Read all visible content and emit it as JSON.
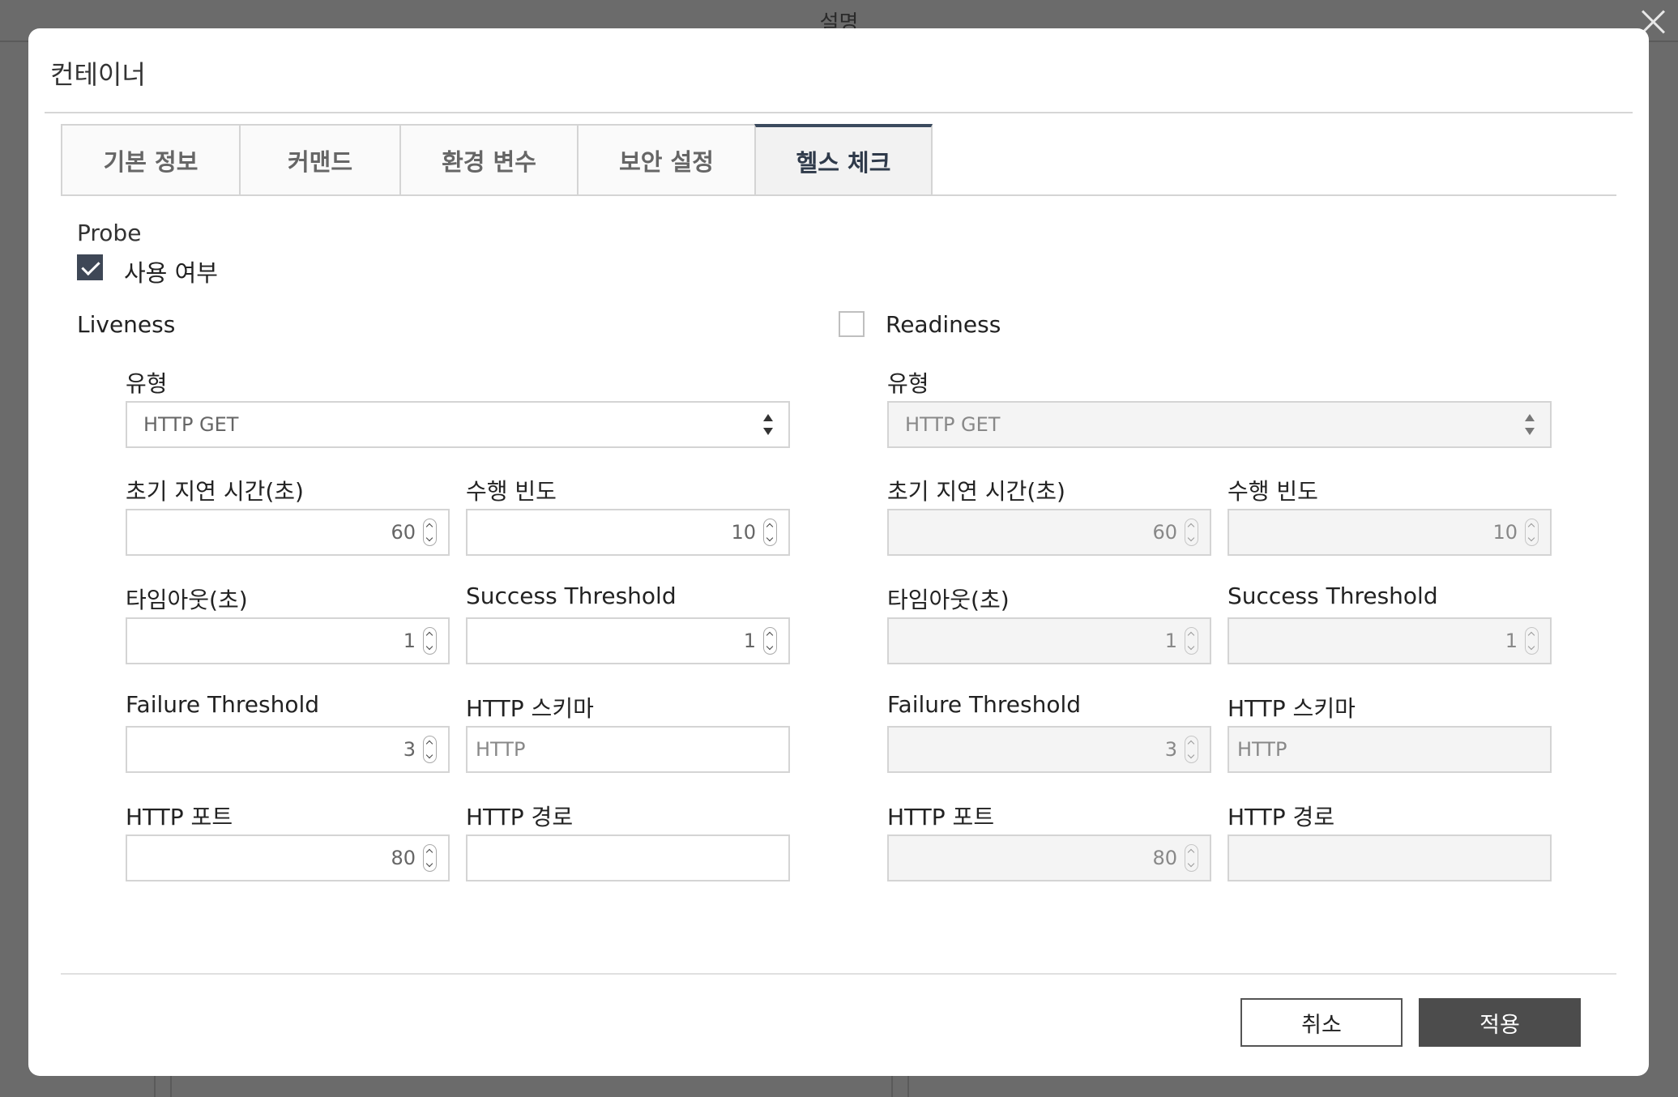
{
  "background": {
    "title": "설명"
  },
  "dialog": {
    "title": "컨테이너",
    "tabs": [
      {
        "label": "기본 정보",
        "active": false
      },
      {
        "label": "커맨드",
        "active": false
      },
      {
        "label": "환경 변수",
        "active": false
      },
      {
        "label": "보안 설정",
        "active": false
      },
      {
        "label": "헬스 체크",
        "active": true
      }
    ],
    "probe": {
      "label": "Probe",
      "enable_label": "사용 여부",
      "enabled": true
    },
    "liveness": {
      "label": "Liveness",
      "type_label": "유형",
      "type_value": "HTTP GET",
      "initial_delay_label": "초기 지연 시간(초)",
      "initial_delay": "60",
      "period_label": "수행 빈도",
      "period": "10",
      "timeout_label": "타임아웃(초)",
      "timeout": "1",
      "success_label": "Success Threshold",
      "success": "1",
      "failure_label": "Failure Threshold",
      "failure": "3",
      "scheme_label": "HTTP 스키마",
      "scheme_placeholder": "HTTP",
      "port_label": "HTTP 포트",
      "port": "80",
      "path_label": "HTTP 경로",
      "path": ""
    },
    "readiness": {
      "label": "Readiness",
      "enabled": false,
      "type_label": "유형",
      "type_value": "HTTP GET",
      "initial_delay_label": "초기 지연 시간(초)",
      "initial_delay": "60",
      "period_label": "수행 빈도",
      "period": "10",
      "timeout_label": "타임아웃(초)",
      "timeout": "1",
      "success_label": "Success Threshold",
      "success": "1",
      "failure_label": "Failure Threshold",
      "failure": "3",
      "scheme_label": "HTTP 스키마",
      "scheme_placeholder": "HTTP",
      "port_label": "HTTP 포트",
      "port": "80",
      "path_label": "HTTP 경로",
      "path": ""
    },
    "buttons": {
      "cancel": "취소",
      "apply": "적용"
    }
  },
  "colors": {
    "tab_active_border": "#3b4a5e",
    "checkbox_checked": "#3e4756",
    "apply_button": "#4c4c4c",
    "overlay": "#6b6b6b"
  }
}
